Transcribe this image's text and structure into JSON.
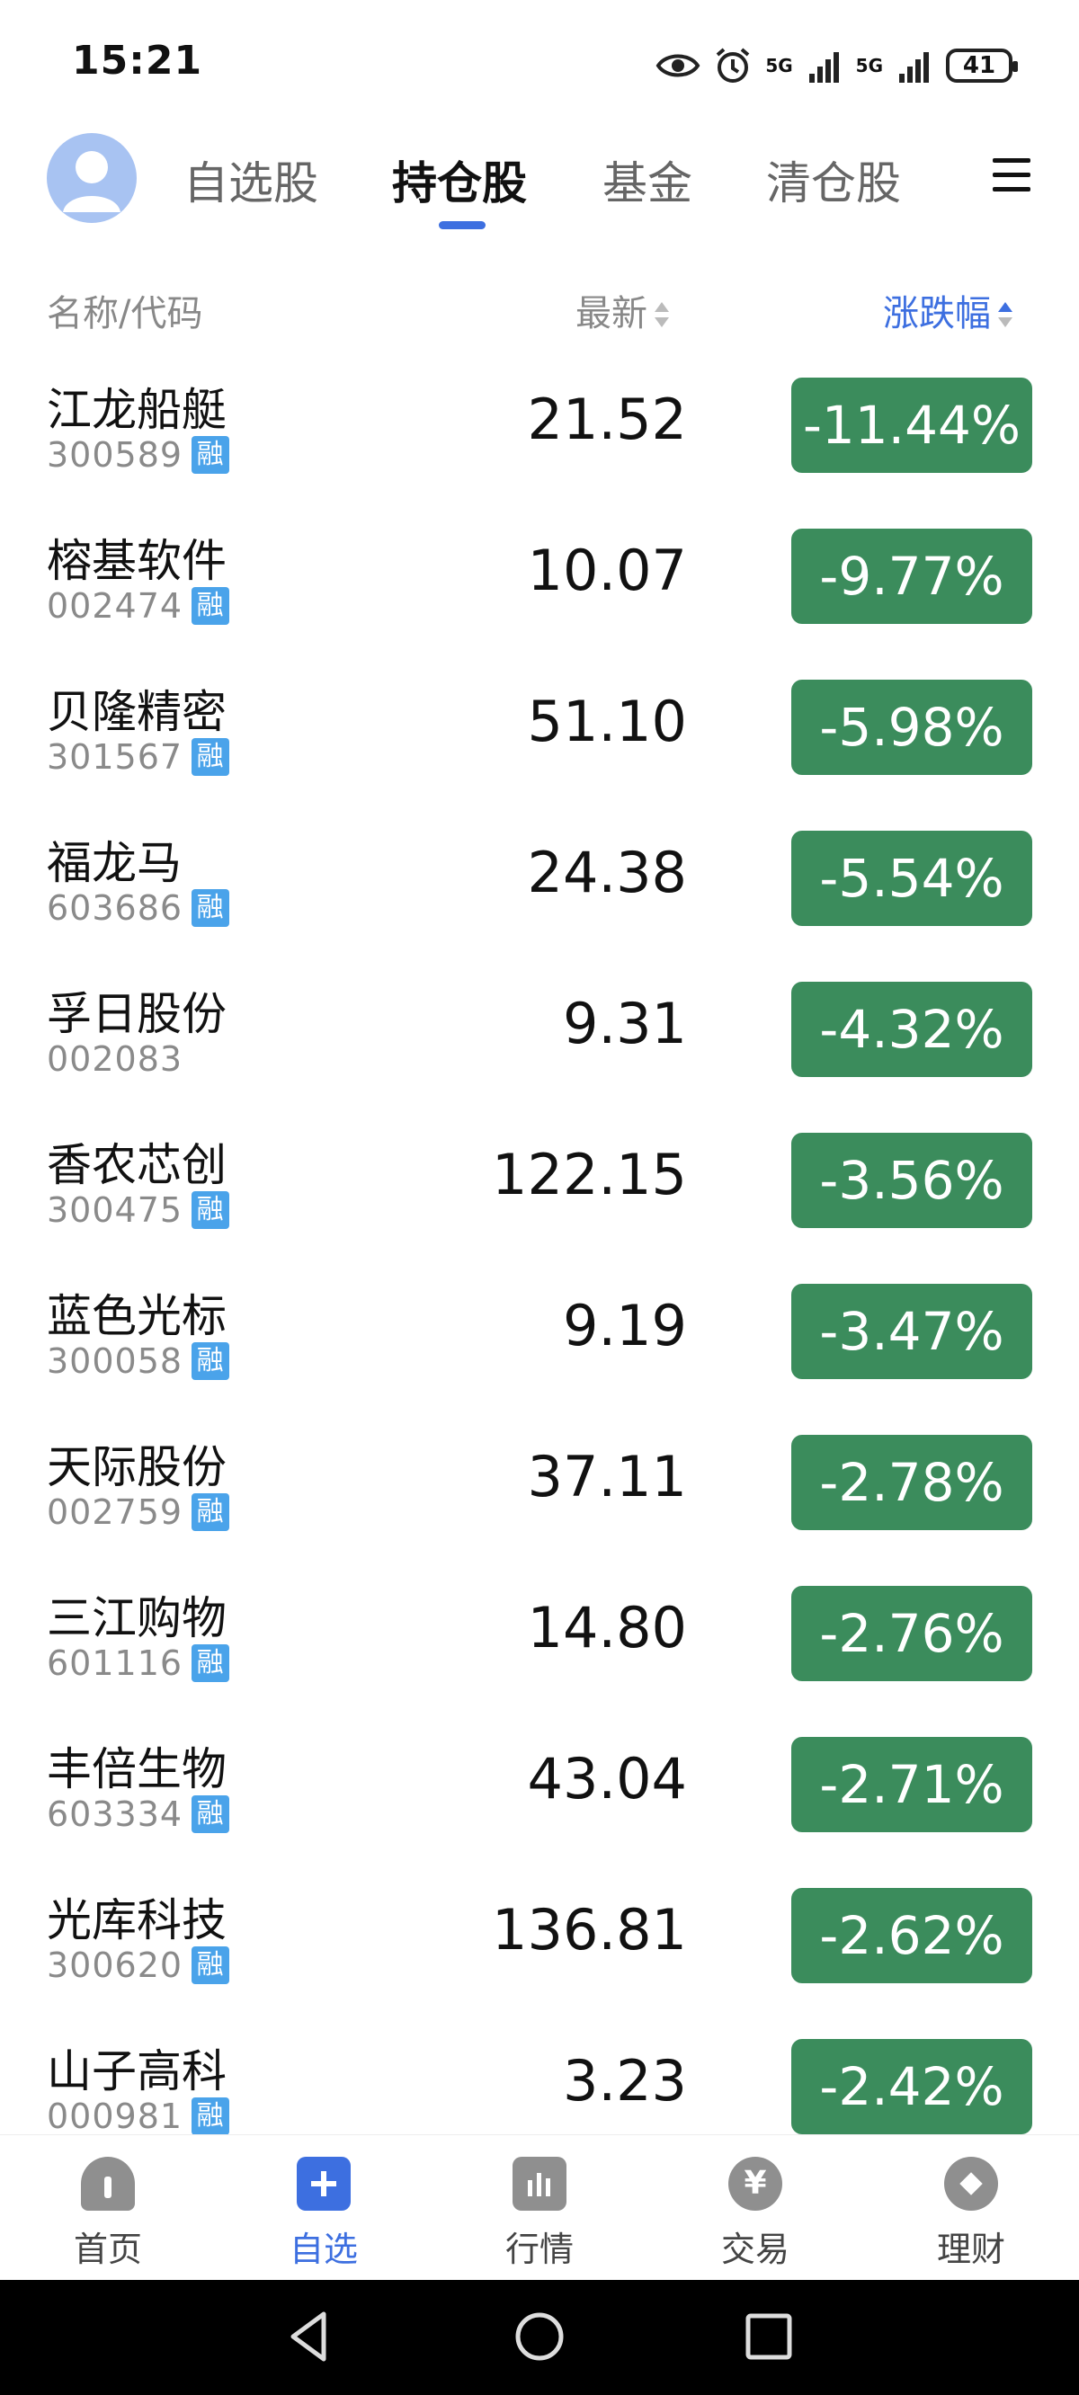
{
  "status": {
    "time": "15:21",
    "sig1": "5G",
    "sig2": "5G",
    "battery": "41"
  },
  "top_tabs": [
    {
      "label": "自选股"
    },
    {
      "label": "持仓股",
      "active": true
    },
    {
      "label": "基金"
    },
    {
      "label": "清仓股"
    }
  ],
  "columns": {
    "name": "名称/代码",
    "latest": "最新",
    "change": "涨跌幅"
  },
  "rong_label": "融",
  "stocks": [
    {
      "name": "江龙船艇",
      "code": "300589",
      "rong": true,
      "price": "21.52",
      "change": "-11.44%"
    },
    {
      "name": "榕基软件",
      "code": "002474",
      "rong": true,
      "price": "10.07",
      "change": "-9.77%"
    },
    {
      "name": "贝隆精密",
      "code": "301567",
      "rong": true,
      "price": "51.10",
      "change": "-5.98%"
    },
    {
      "name": "福龙马",
      "code": "603686",
      "rong": true,
      "price": "24.38",
      "change": "-5.54%"
    },
    {
      "name": "孚日股份",
      "code": "002083",
      "rong": false,
      "price": "9.31",
      "change": "-4.32%"
    },
    {
      "name": "香农芯创",
      "code": "300475",
      "rong": true,
      "price": "122.15",
      "change": "-3.56%"
    },
    {
      "name": "蓝色光标",
      "code": "300058",
      "rong": true,
      "price": "9.19",
      "change": "-3.47%"
    },
    {
      "name": "天际股份",
      "code": "002759",
      "rong": true,
      "price": "37.11",
      "change": "-2.78%"
    },
    {
      "name": "三江购物",
      "code": "601116",
      "rong": true,
      "price": "14.80",
      "change": "-2.76%"
    },
    {
      "name": "丰倍生物",
      "code": "603334",
      "rong": true,
      "price": "43.04",
      "change": "-2.71%"
    },
    {
      "name": "光库科技",
      "code": "300620",
      "rong": true,
      "price": "136.81",
      "change": "-2.62%"
    },
    {
      "name": "山子高科",
      "code": "000981",
      "rong": true,
      "price": "3.23",
      "change": "-2.42%"
    }
  ],
  "bottom_nav": [
    {
      "label": "首页",
      "icon": "home-icon"
    },
    {
      "label": "自选",
      "icon": "plus-icon",
      "active": true
    },
    {
      "label": "行情",
      "icon": "chart-bars-icon"
    },
    {
      "label": "交易",
      "icon": "yen-icon"
    },
    {
      "label": "理财",
      "icon": "diamond-icon"
    }
  ],
  "colors": {
    "accent": "#3d6fe0",
    "down_green": "#3b8c5c",
    "badge_blue": "#4aa3ea"
  }
}
